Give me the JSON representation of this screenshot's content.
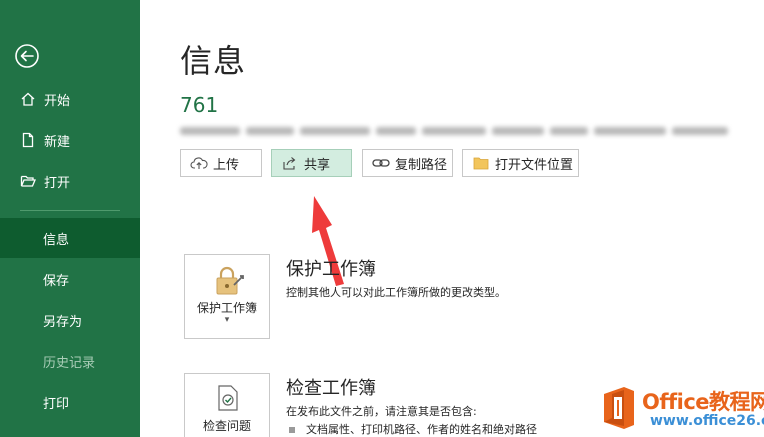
{
  "sidebar": {
    "items": [
      {
        "label": "开始",
        "icon": "home-icon"
      },
      {
        "label": "新建",
        "icon": "new-file-icon"
      },
      {
        "label": "打开",
        "icon": "open-folder-icon"
      },
      {
        "label": "信息",
        "active": true
      },
      {
        "label": "保存"
      },
      {
        "label": "另存为"
      },
      {
        "label": "历史记录",
        "disabled": true
      },
      {
        "label": "打印"
      }
    ],
    "accent_color": "#217346",
    "active_color": "#0e5c2f"
  },
  "main": {
    "title": "信息",
    "file_name": "761",
    "toolbar": {
      "upload_label": "上传",
      "share_label": "共享",
      "copy_path_label": "复制路径",
      "open_location_label": "打开文件位置"
    },
    "protect": {
      "card_label": "保护工作簿",
      "title": "保护工作簿",
      "description": "控制其他人可以对此工作簿所做的更改类型。"
    },
    "inspect": {
      "card_label": "检查问题",
      "title": "检查工作簿",
      "description": "在发布此文件之前，请注意其是否包含:",
      "bullets": [
        "文档属性、打印机路径、作者的姓名和绝对路径"
      ]
    }
  },
  "watermark": {
    "brand": "Office教程网",
    "url": "www.office26.com"
  }
}
